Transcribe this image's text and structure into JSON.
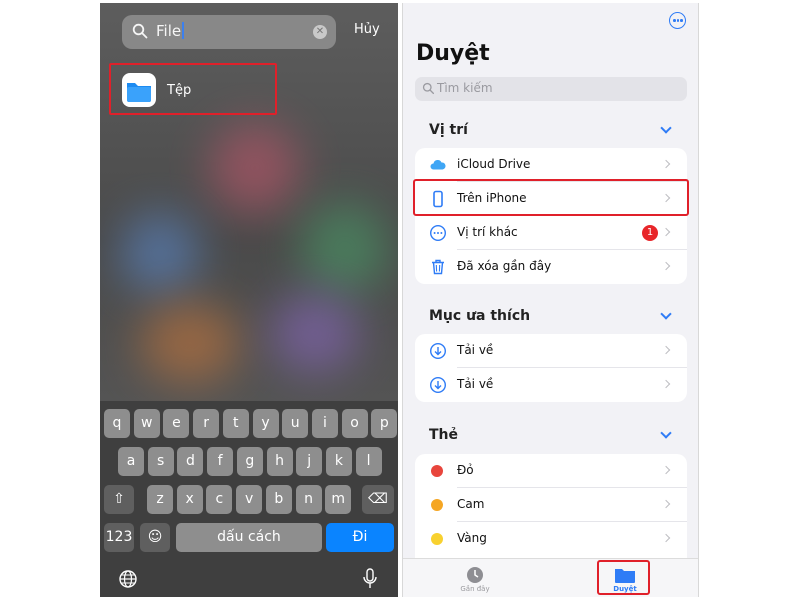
{
  "left": {
    "search": {
      "value": "File",
      "cancel_label": "Hủy"
    },
    "result": {
      "label": "Tệp"
    },
    "keyboard": {
      "row1": [
        "q",
        "w",
        "e",
        "r",
        "t",
        "y",
        "u",
        "i",
        "o",
        "p"
      ],
      "row2": [
        "a",
        "s",
        "d",
        "f",
        "g",
        "h",
        "j",
        "k",
        "l"
      ],
      "row3": [
        "z",
        "x",
        "c",
        "v",
        "b",
        "n",
        "m"
      ],
      "numbers_label": "123",
      "space_label": "dấu cách",
      "go_label": "Đi"
    }
  },
  "right": {
    "title": "Duyệt",
    "search_placeholder": "Tìm kiếm",
    "sections": [
      {
        "title": "Vị trí",
        "items": [
          {
            "label": "iCloud Drive",
            "icon": "cloud-icon"
          },
          {
            "label": "Trên iPhone",
            "icon": "iphone-icon"
          },
          {
            "label": "Vị trí khác",
            "icon": "more-circle-icon",
            "badge": "1"
          },
          {
            "label": "Đã xóa gần đây",
            "icon": "trash-icon"
          }
        ]
      },
      {
        "title": "Mục ưa thích",
        "items": [
          {
            "label": "Tải về",
            "icon": "download-icon"
          },
          {
            "label": "Tải về",
            "icon": "download-icon"
          }
        ]
      },
      {
        "title": "Thẻ",
        "items": [
          {
            "label": "Đỏ",
            "color": "#e8453c"
          },
          {
            "label": "Cam",
            "color": "#f5a623"
          },
          {
            "label": "Vàng",
            "color": "#f8d12f"
          }
        ]
      }
    ],
    "tabs": [
      {
        "label": "Gần đây",
        "active": false
      },
      {
        "label": "Duyệt",
        "active": true
      }
    ]
  },
  "colors": {
    "accent": "#2f7cf6",
    "highlight": "#e0202a",
    "badge": "#e8262a"
  }
}
